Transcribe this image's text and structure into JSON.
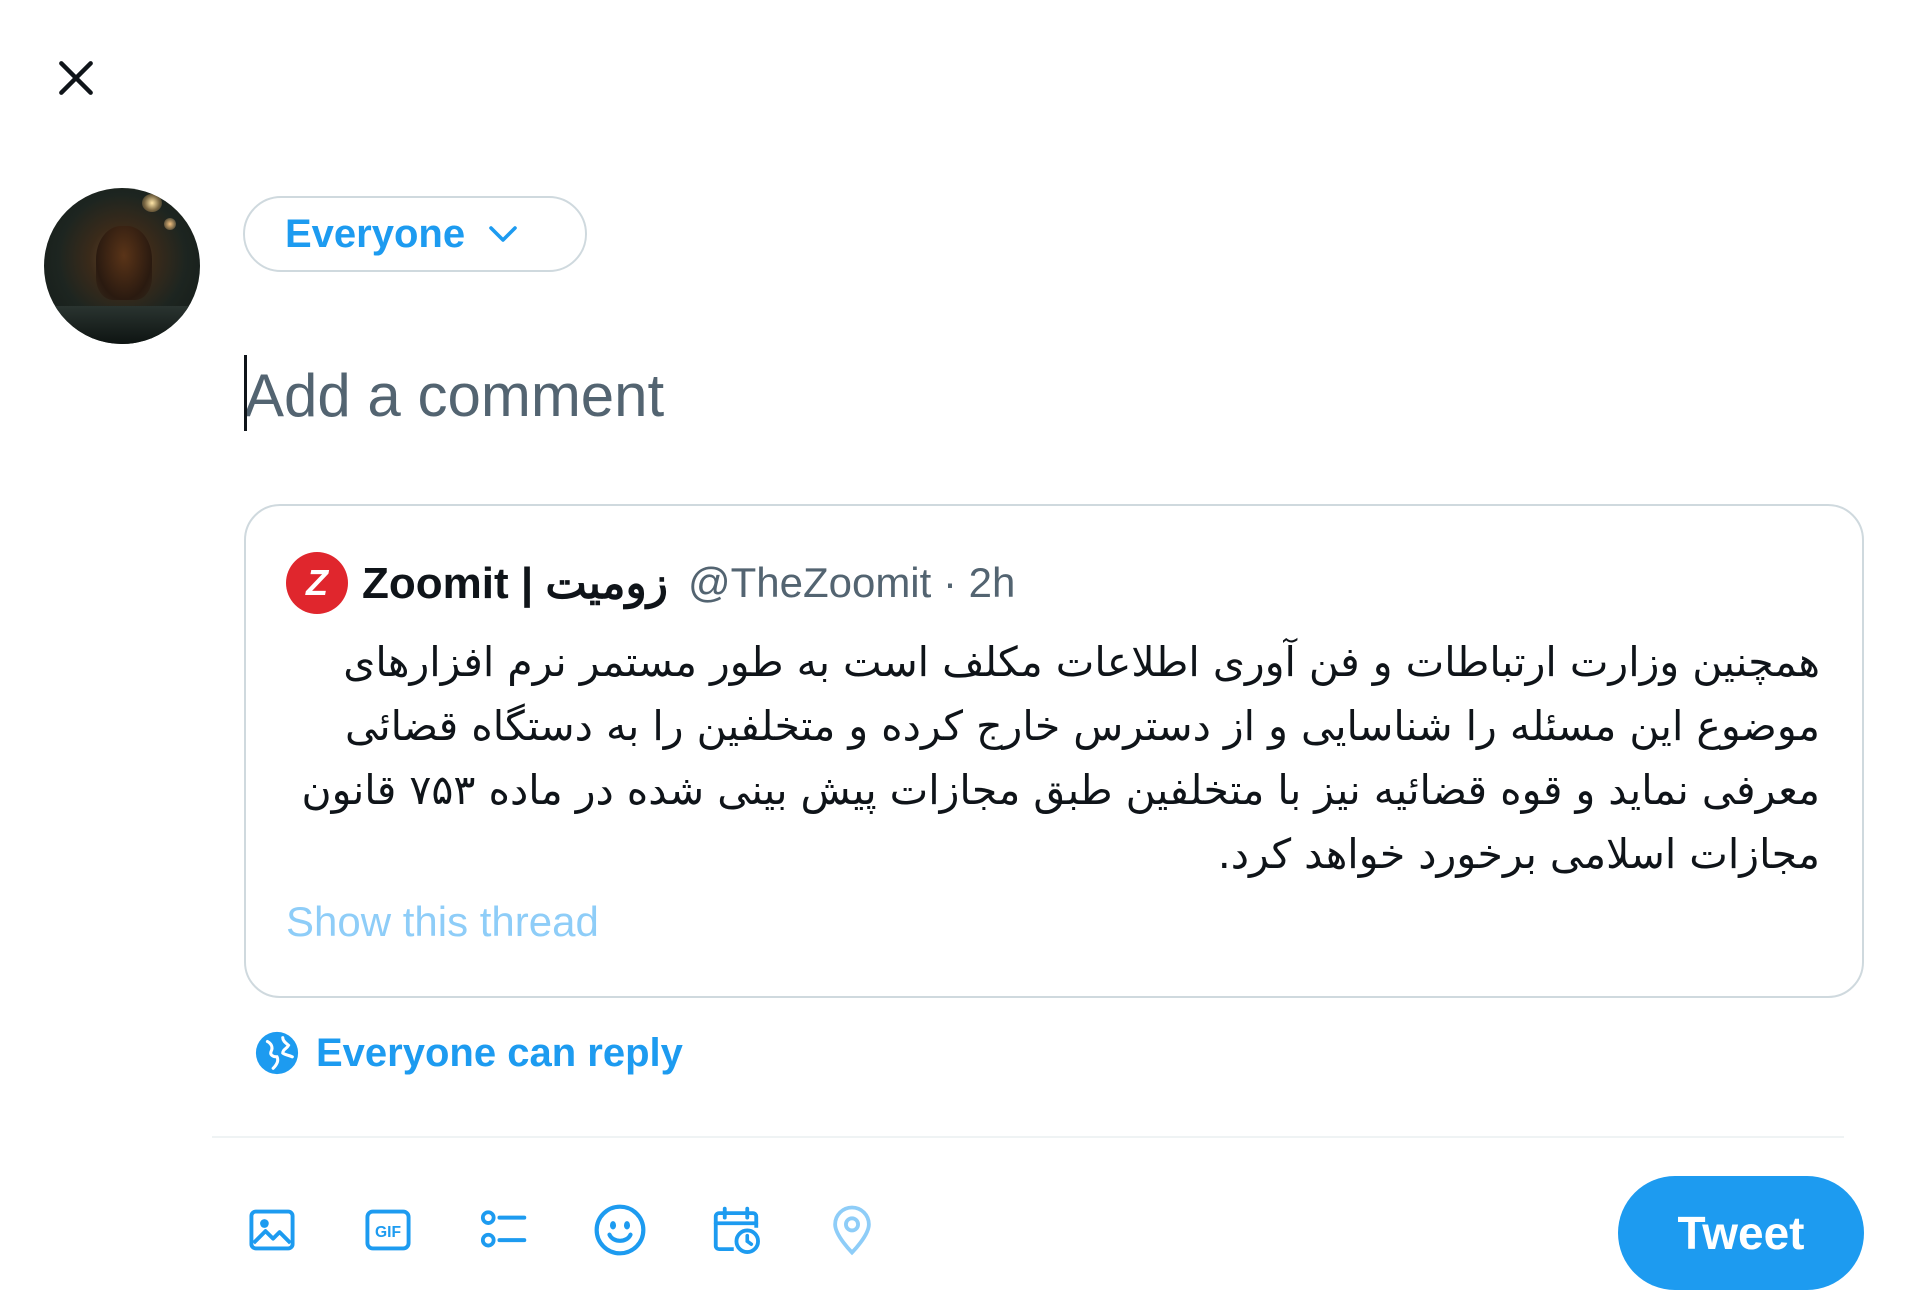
{
  "header": {
    "close_icon": "close-icon"
  },
  "composer": {
    "audience_label": "Everyone",
    "placeholder": "Add a comment"
  },
  "quote": {
    "logo_letter": "Z",
    "name": "Zoomit | زومیت",
    "handle_time": "@TheZoomit · 2h",
    "text": "همچنین وزارت ارتباطات و فن آوری اطلاعات مکلف است به طور مستمر نرم افزارهای موضوع این مسئله را شناسایی و از دسترس خارج کرده و متخلفین را به دستگاه قضائی معرفی نماید و قوه قضائیه نیز با متخلفین طبق مجازات پیش بینی شده در ماده ۷۵۳ قانون مجازات اسلامی برخورد خواهد کرد.",
    "show_thread": "Show this thread"
  },
  "reply_setting": {
    "label": "Everyone can reply",
    "icon": "globe-icon"
  },
  "toolbar": {
    "icons": [
      "image-icon",
      "gif-icon",
      "poll-icon",
      "emoji-icon",
      "schedule-icon",
      "location-icon"
    ],
    "gif_text": "GIF"
  },
  "tweet_button": {
    "label": "Tweet"
  },
  "colors": {
    "accent": "#1d9bf0",
    "border": "#cfd9de",
    "brand_red": "#e0262d"
  }
}
